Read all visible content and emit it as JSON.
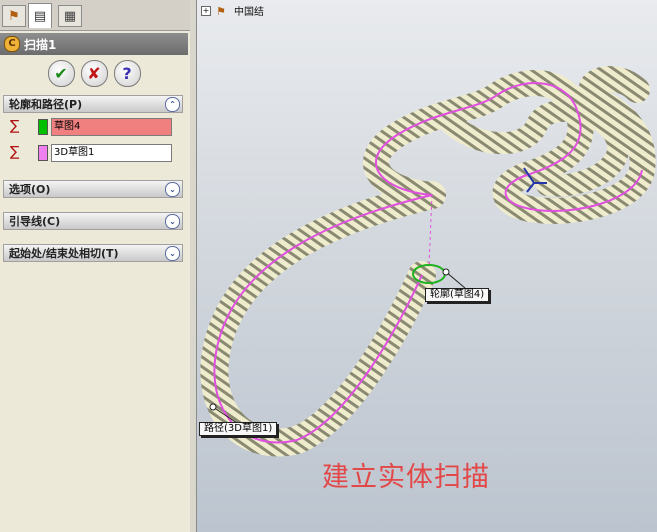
{
  "tabs": [
    {
      "name": "feature-manager-tab",
      "icon": "feature-tree-icon"
    },
    {
      "name": "property-manager-tab",
      "icon": "property-sheet-icon"
    },
    {
      "name": "configuration-manager-tab",
      "icon": "configuration-icon"
    }
  ],
  "property_manager": {
    "title": "扫描1",
    "title_icon": "sweep-feature-icon",
    "ok_icon": "checkmark-icon",
    "cancel_icon": "cross-icon",
    "help_icon": "question-icon"
  },
  "groups": {
    "profile_path": {
      "label": "轮廓和路径(P)",
      "profile_value": "草图4",
      "profile_color": "#f08080",
      "profile_swatch": "#00c000",
      "path_value": "3D草图1",
      "path_color": "#ffffff",
      "path_swatch": "#f080f0"
    },
    "options": {
      "label": "选项(O)"
    },
    "guides": {
      "label": "引导线(C)"
    },
    "tangency": {
      "label": "起始处/结束处相切(T)"
    }
  },
  "viewport": {
    "tree_root": "中国结",
    "profile_callout": "轮廓(草图4)",
    "path_callout": "路径(3D草图1)",
    "caption": "建立实体扫描",
    "caption_color": "#e24848"
  }
}
